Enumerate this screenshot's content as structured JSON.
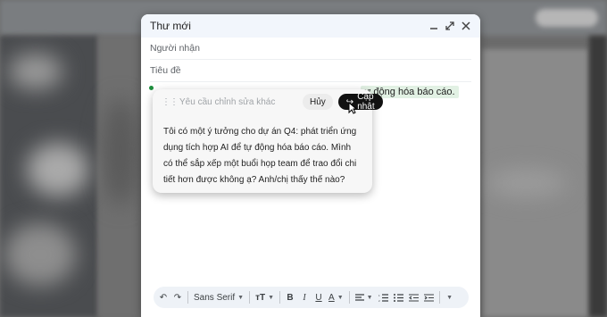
{
  "compose": {
    "title": "Thư mới",
    "controls": {
      "minimize_icon": "minimize-icon",
      "expand_icon": "expand-icon",
      "close_icon": "close-icon"
    },
    "to_placeholder": "Người nhận",
    "subject_placeholder": "Tiêu đề",
    "body_visible_fragment": "ự động hóa báo cáo."
  },
  "ai_popup": {
    "input_placeholder": "Yêu cầu chỉnh sửa khác",
    "cancel_label": "Hủy",
    "update_label": "Cập nhật",
    "suggestion_text": "Tôi có một ý tưởng cho dự án Q4: phát triển ứng dụng tích hợp AI để tự động hóa báo cáo. Mình có thể sắp xếp một buổi họp team để trao đổi chi tiết hơn được không ạ? Anh/chị thấy thế nào?"
  },
  "toolbar": {
    "undo_icon": "undo-icon",
    "redo_icon": "redo-icon",
    "font_family": "Sans Serif",
    "font_size_icon": "text-size-icon",
    "bold_icon": "bold-icon",
    "italic_icon": "italic-icon",
    "underline_icon": "underline-icon",
    "text_color_icon": "text-color-icon",
    "align_icon": "align-icon",
    "numbered_list_icon": "numbered-list-icon",
    "bullet_list_icon": "bullet-list-icon",
    "indent_less_icon": "indent-less-icon",
    "indent_more_icon": "indent-more-icon",
    "more_icon": "more-options-icon"
  },
  "colors": {
    "header_bg": "#f2f6fc",
    "highlight": "#e2f1e4",
    "update_button": "#111111",
    "toolbar_bg": "#eef2f7"
  }
}
